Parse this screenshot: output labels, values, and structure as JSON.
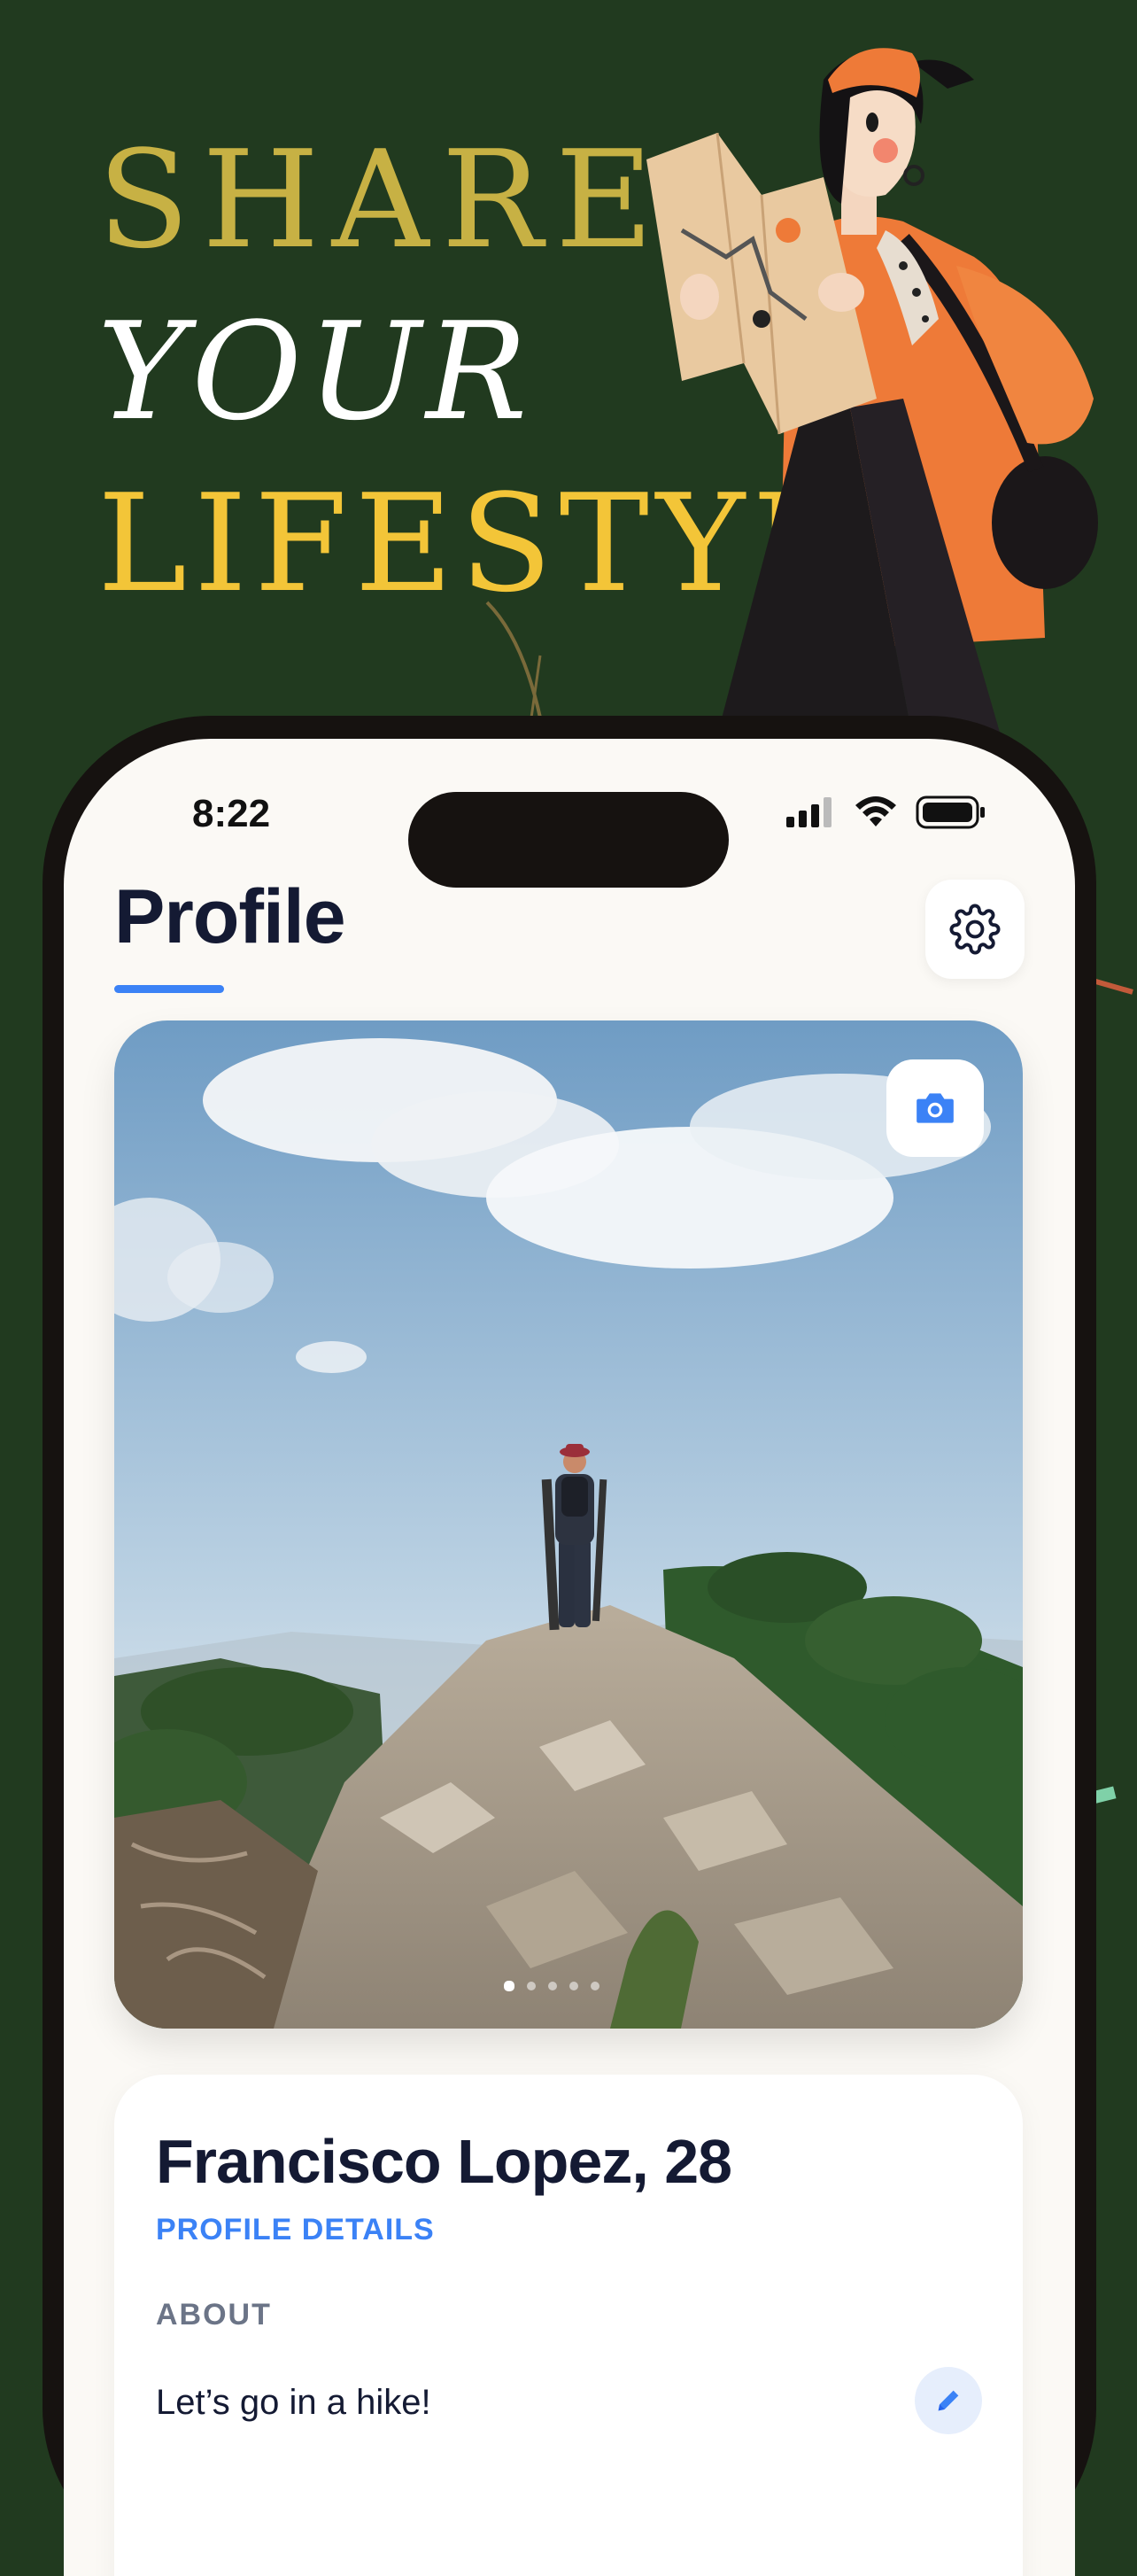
{
  "headline": {
    "line1": "SHARE",
    "line2": "YOUR",
    "line3": "LIFESTYLE"
  },
  "status_bar": {
    "time": "8:22",
    "icons": [
      "signal-icon",
      "wifi-icon",
      "battery-icon"
    ]
  },
  "header": {
    "title": "Profile",
    "settings_icon": "gear-icon"
  },
  "photo": {
    "description_icon": "camera-icon",
    "carousel_dots": 5,
    "active_dot": 1
  },
  "profile": {
    "name": "Francisco Lopez, 28",
    "details_link": "PROFILE DETAILS",
    "about_label": "ABOUT",
    "about_text": "Let’s go in a hike!",
    "edit_icon": "pencil-icon"
  },
  "colors": {
    "background": "#213a1f",
    "accent": "#3b82f6",
    "headline_gold": "#c7b144",
    "headline_yellow": "#f3c538"
  }
}
